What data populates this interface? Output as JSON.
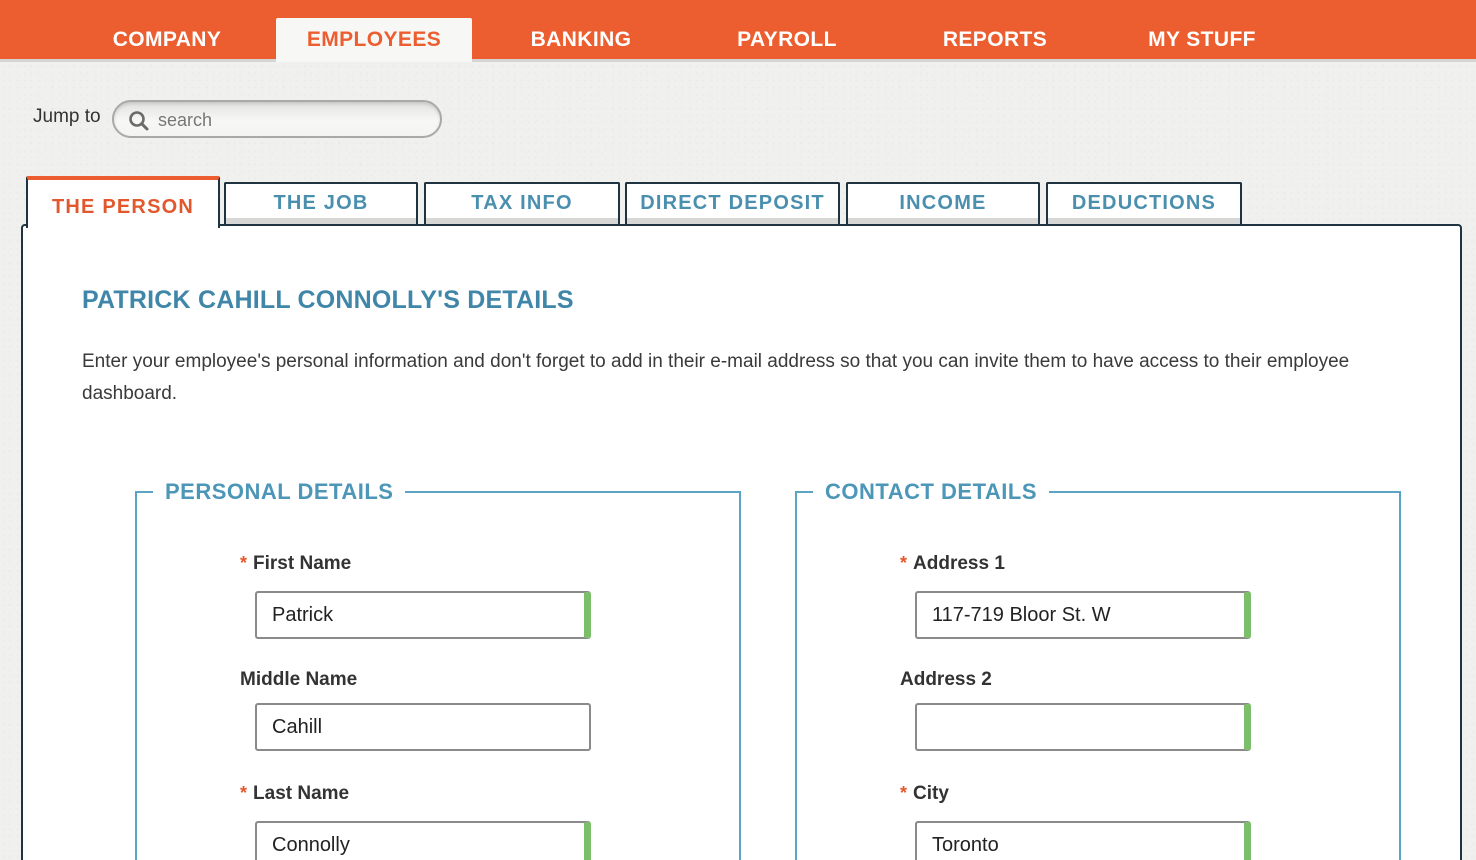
{
  "nav": {
    "items": [
      {
        "label": "COMPANY"
      },
      {
        "label": "EMPLOYEES",
        "active": true
      },
      {
        "label": "BANKING"
      },
      {
        "label": "PAYROLL"
      },
      {
        "label": "REPORTS"
      },
      {
        "label": "MY STUFF"
      }
    ]
  },
  "jump": {
    "label": "Jump to",
    "placeholder": "search",
    "icon": "search-icon"
  },
  "tabs": [
    {
      "label": "THE PERSON",
      "active": true
    },
    {
      "label": "THE JOB"
    },
    {
      "label": "TAX INFO"
    },
    {
      "label": "DIRECT DEPOSIT"
    },
    {
      "label": "INCOME"
    },
    {
      "label": "DEDUCTIONS"
    }
  ],
  "main": {
    "title": "PATRICK CAHILL CONNOLLY'S DETAILS",
    "description": "Enter your employee's personal information and don't forget to add in their e-mail address so that you can invite them to have access to their employee dashboard."
  },
  "personal": {
    "legend": "PERSONAL DETAILS",
    "fields": [
      {
        "label": "First Name",
        "required": "*",
        "value": "Patrick"
      },
      {
        "label": "Middle Name",
        "value": "Cahill"
      },
      {
        "label": "Last Name",
        "required": "*",
        "value": "Connolly"
      }
    ]
  },
  "contact": {
    "legend": "CONTACT DETAILS",
    "fields": [
      {
        "label": "Address 1",
        "required": "*",
        "value": "117-719 Bloor St. W"
      },
      {
        "label": "Address 2",
        "value": ""
      },
      {
        "label": "City",
        "required": "*",
        "value": "Toronto"
      }
    ]
  },
  "colors": {
    "brand": "#ec5e2f",
    "accent": "#3f86a8",
    "valid": "#7cbf6a"
  }
}
